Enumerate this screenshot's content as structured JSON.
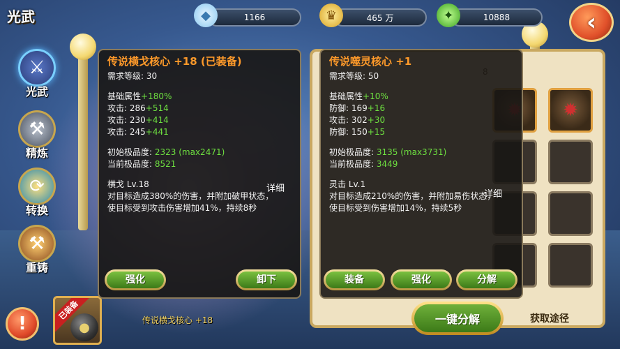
{
  "header": {
    "title": "光武",
    "diamonds": "1166",
    "gold": "465 万",
    "energy": "10888"
  },
  "nav": [
    {
      "label": "光武",
      "icon": "sword-icon"
    },
    {
      "label": "精炼",
      "icon": "anvil-icon"
    },
    {
      "label": "转换",
      "icon": "convert-icon"
    },
    {
      "label": "重铸",
      "icon": "hammer-icon"
    }
  ],
  "equipped_item": {
    "tag": "已装备",
    "name": "传说横戈核心 +18"
  },
  "inventory": {
    "count": "8",
    "decompose_label": "一键分解",
    "obtain_label": "获取途径"
  },
  "left_tip": {
    "name": "传说横戈核心 +18 (已装备)",
    "level_req": "需求等级: 30",
    "base_label": "基础属性",
    "base_bonus": "+180%",
    "stats": [
      {
        "name": "攻击:",
        "base": "286",
        "bonus": "+514"
      },
      {
        "name": "攻击:",
        "base": "230",
        "bonus": "+414"
      },
      {
        "name": "攻击:",
        "base": "245",
        "bonus": "+441"
      }
    ],
    "init_quality_label": "初始极品度:",
    "init_quality_value": "2323 (max2471)",
    "cur_quality_label": "当前极品度:",
    "cur_quality_value": "8521",
    "detail_label": "详细",
    "skill_name": "横戈 Lv.18",
    "skill_desc": "对目标造成380%的伤害，并附加破甲状态，使目标受到攻击伤害增加41%，持续8秒",
    "btn_strengthen": "强化",
    "btn_unequip": "卸下"
  },
  "right_tip": {
    "name": "传说噬灵核心 +1",
    "level_req": "需求等级: 50",
    "base_label": "基础属性",
    "base_bonus": "+10%",
    "stats": [
      {
        "name": "防御:",
        "base": "169",
        "bonus": "+16"
      },
      {
        "name": "攻击:",
        "base": "302",
        "bonus": "+30"
      },
      {
        "name": "防御:",
        "base": "150",
        "bonus": "+15"
      }
    ],
    "init_quality_label": "初始极品度:",
    "init_quality_value": "3135 (max3731)",
    "cur_quality_label": "当前极品度:",
    "cur_quality_value": "3449",
    "detail_label": "详细",
    "skill_name": "灵击 Lv.1",
    "skill_desc": "对目标造成210%的伤害，并附加易伤状态，使目标受到伤害增加14%，持续5秒",
    "btn_equip": "装备",
    "btn_strengthen": "强化",
    "btn_decompose": "分解"
  }
}
